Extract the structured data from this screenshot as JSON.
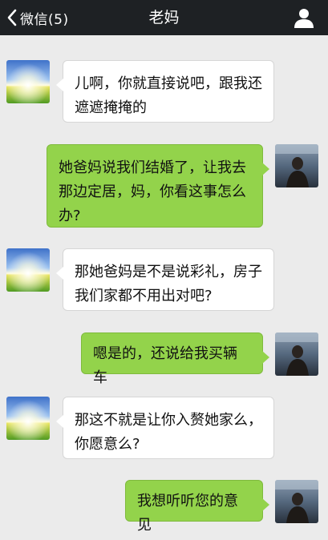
{
  "header": {
    "back_label": "微信(5)",
    "title": "老妈"
  },
  "colors": {
    "topbar": "#1e2124",
    "chat_background": "#ebebeb",
    "incoming_bubble": "#ffffff",
    "outgoing_bubble": "#93d34b"
  },
  "icons": {
    "back": "chevron-left-icon",
    "profile": "person-icon"
  },
  "messages": [
    {
      "side": "left",
      "text": "儿啊，你就直接说吧，跟我还遮遮掩掩的"
    },
    {
      "side": "right",
      "text": "她爸妈说我们结婚了，让我去那边定居，妈，你看这事怎么办?"
    },
    {
      "side": "left",
      "text": "那她爸妈是不是说彩礼，房子我们家都不用出对吧?"
    },
    {
      "side": "right",
      "text": "嗯是的，还说给我买辆车"
    },
    {
      "side": "left",
      "text": "那这不就是让你入赘她家么，你愿意么?"
    },
    {
      "side": "right",
      "text": "我想听听您的意见"
    }
  ]
}
